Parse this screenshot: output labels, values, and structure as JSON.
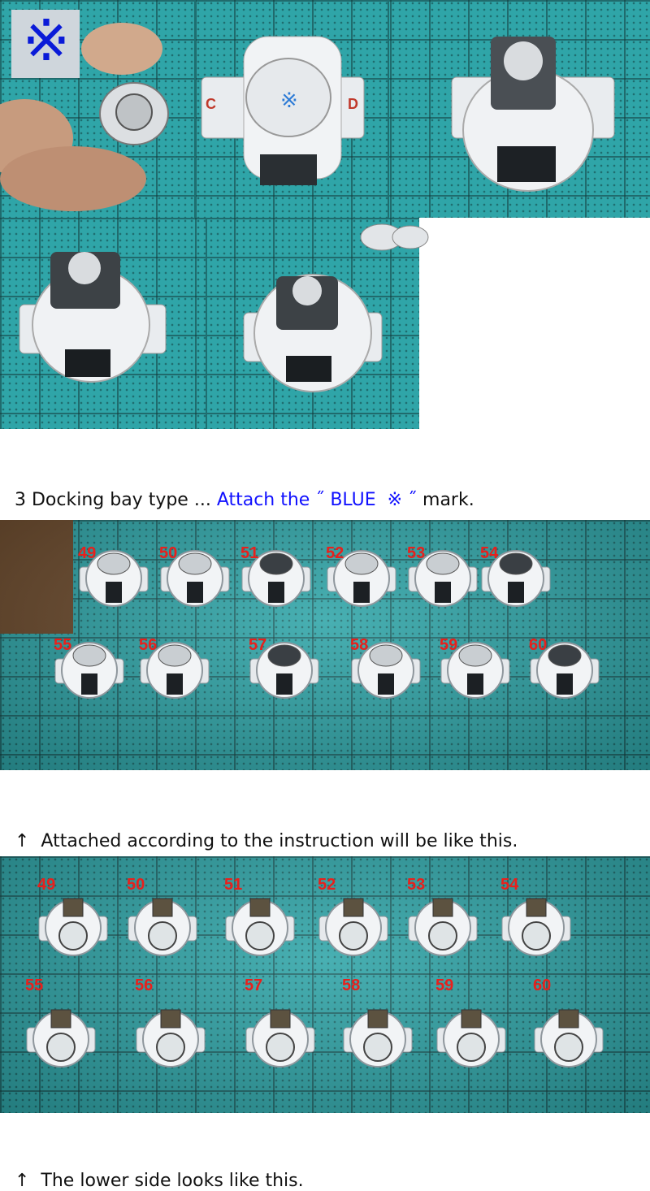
{
  "captions": {
    "c1_prefix": "3 Docking bay type ... ",
    "c1_blue": "Attach the ˝ BLUE  ※ ˝",
    "c1_suffix": " mark.",
    "c2_arrow": "↑",
    "c2_text": "  Attached according to the instruction will be like this.",
    "c3_arrow": "↑",
    "c3_text": "  The lower side looks like this."
  },
  "top_photo": {
    "mark_symbol": "※",
    "mark_color": "#0a1bd8",
    "side_labels": [
      "C",
      "D"
    ]
  },
  "photo_top_numbers": [
    "49",
    "50",
    "51",
    "52",
    "53",
    "54",
    "55",
    "56",
    "57",
    "58",
    "59",
    "60"
  ],
  "photo_bottom_numbers": [
    "49",
    "50",
    "51",
    "52",
    "53",
    "54",
    "55",
    "56",
    "57",
    "58",
    "59",
    "60"
  ],
  "colors": {
    "mat": "#2fa5a8",
    "number_red": "#e8201c",
    "caption_blue": "#1010ff"
  }
}
